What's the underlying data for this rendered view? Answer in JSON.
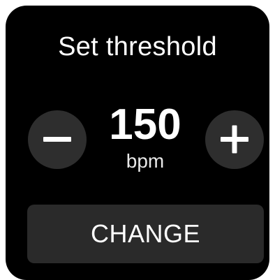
{
  "screen": {
    "title": "Set threshold"
  },
  "threshold": {
    "value": "150",
    "unit": "bpm"
  },
  "controls": {
    "decrement_icon": "minus-icon",
    "increment_icon": "plus-icon",
    "change_label": "CHANGE"
  },
  "colors": {
    "background": "#000000",
    "button_background": "#2e2e2e",
    "text": "#ffffff"
  }
}
